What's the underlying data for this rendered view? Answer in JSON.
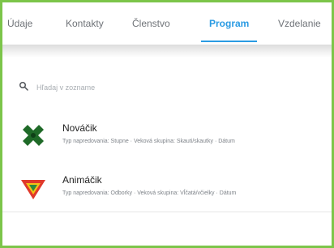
{
  "tabs": [
    {
      "label": "Údaje"
    },
    {
      "label": "Kontakty"
    },
    {
      "label": "Členstvo"
    },
    {
      "label": "Program"
    },
    {
      "label": "Vzdelanie"
    }
  ],
  "active_tab": "Program",
  "search": {
    "placeholder": "Hľadaj v zozname",
    "icon": "search-icon"
  },
  "programs": [
    {
      "name": "Nováčik",
      "icon": "green-cross-badge-icon",
      "details": "Typ napredovania: Stupne · Veková skupina: Skauti/skautky · Dátum"
    },
    {
      "name": "Animáčik",
      "icon": "triangle-shield-badge-icon",
      "details": "Typ napredovania: Odborky · Veková skupina: Vĺčatá/včielky · Dátum"
    }
  ],
  "colors": {
    "accent": "#2a9be3",
    "frame": "#7cc54a"
  }
}
